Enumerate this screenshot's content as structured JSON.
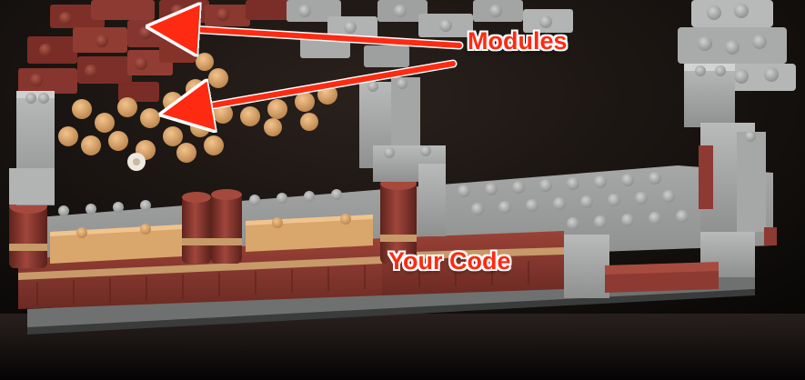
{
  "annotations": {
    "modules_label": "Modules",
    "code_label": "Your Code"
  },
  "colors": {
    "annotation": "#ff2a12",
    "annotation_outline": "#ffffff",
    "dark_red_brick": "#8c3a32",
    "tan_brick": "#d9a66c",
    "light_gray_brick": "#a7a8a8",
    "background": "#0d0b0a"
  }
}
